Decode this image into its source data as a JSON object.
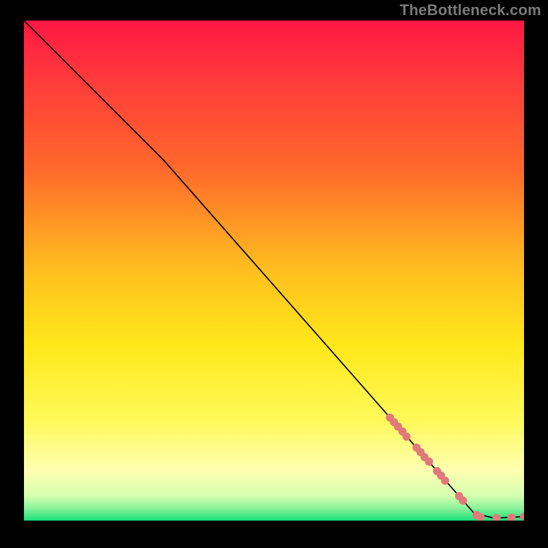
{
  "watermark": "TheBottleneck.com",
  "chart_data": {
    "type": "line",
    "title": "",
    "xlabel": "",
    "ylabel": "",
    "xlim": [
      0,
      100
    ],
    "ylim": [
      0,
      100
    ],
    "grid": false,
    "legend": false,
    "gradient_stops": [
      {
        "offset": 0,
        "color": "#ff1744"
      },
      {
        "offset": 0.12,
        "color": "#ff3b3b"
      },
      {
        "offset": 0.3,
        "color": "#ff6a2b"
      },
      {
        "offset": 0.5,
        "color": "#ffbf1f"
      },
      {
        "offset": 0.65,
        "color": "#ffe81a"
      },
      {
        "offset": 0.8,
        "color": "#fff95a"
      },
      {
        "offset": 0.9,
        "color": "#fdffb0"
      },
      {
        "offset": 0.95,
        "color": "#d6ffb0"
      },
      {
        "offset": 0.975,
        "color": "#8cf29a"
      },
      {
        "offset": 1.0,
        "color": "#18e07a"
      }
    ],
    "series": [
      {
        "name": "curve",
        "type": "line",
        "color": "#000000",
        "width": 1.8,
        "points": [
          {
            "x": 0,
            "y": 100
          },
          {
            "x": 28,
            "y": 72
          },
          {
            "x": 90,
            "y": 1.5
          },
          {
            "x": 94,
            "y": 0.5
          },
          {
            "x": 100,
            "y": 0.8
          }
        ]
      },
      {
        "name": "markers",
        "type": "scatter",
        "color": "#e07a7a",
        "radius": 6,
        "points": [
          {
            "x": 73.2,
            "y": 20.6
          },
          {
            "x": 74.0,
            "y": 19.7
          },
          {
            "x": 74.8,
            "y": 18.8
          },
          {
            "x": 75.7,
            "y": 17.8
          },
          {
            "x": 76.5,
            "y": 16.8
          },
          {
            "x": 78.5,
            "y": 14.6
          },
          {
            "x": 79.3,
            "y": 13.7
          },
          {
            "x": 80.1,
            "y": 12.7
          },
          {
            "x": 81.0,
            "y": 11.8
          },
          {
            "x": 82.6,
            "y": 9.9
          },
          {
            "x": 83.4,
            "y": 9.0
          },
          {
            "x": 84.2,
            "y": 8.0
          },
          {
            "x": 87.0,
            "y": 4.9
          },
          {
            "x": 87.8,
            "y": 4.0
          },
          {
            "x": 90.5,
            "y": 1.1
          },
          {
            "x": 91.3,
            "y": 0.7
          },
          {
            "x": 94.5,
            "y": 0.5
          },
          {
            "x": 97.5,
            "y": 0.6
          },
          {
            "x": 100,
            "y": 0.8
          }
        ]
      }
    ]
  }
}
